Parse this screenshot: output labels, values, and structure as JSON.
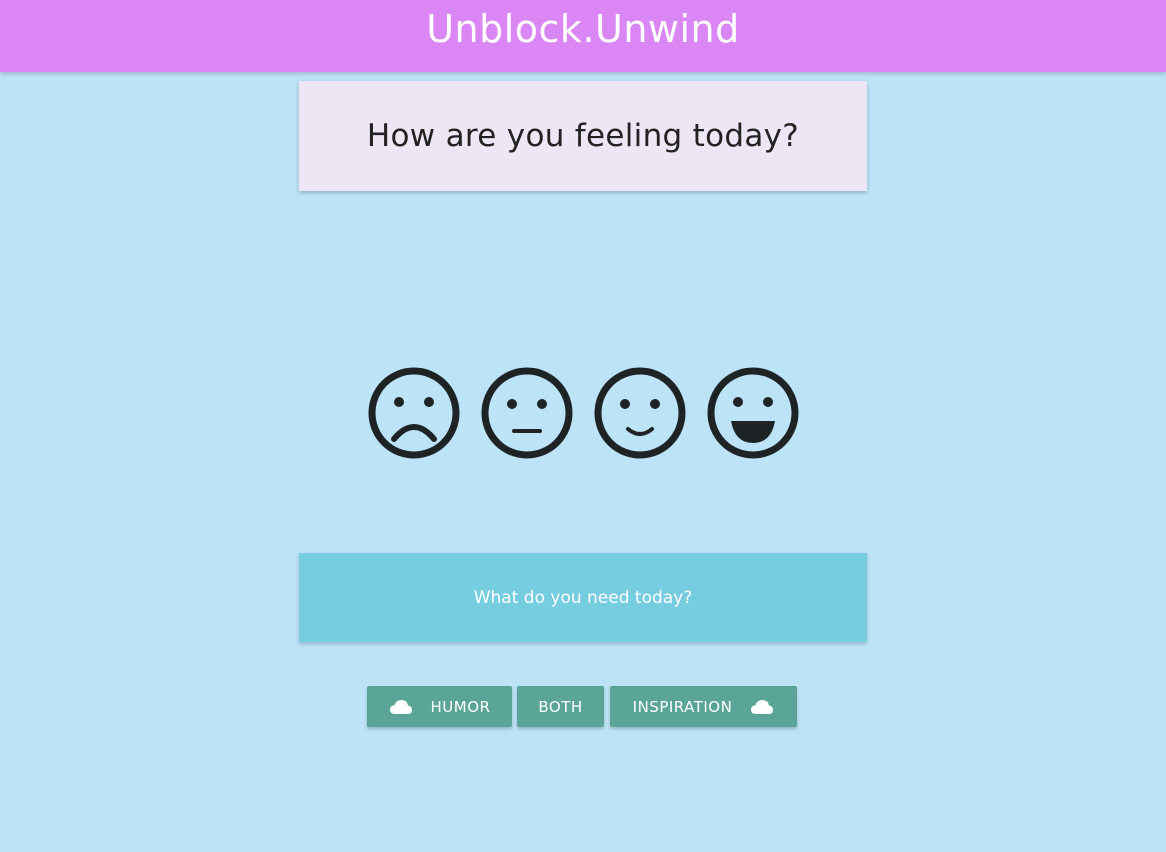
{
  "header": {
    "title": "Unblock.Unwind"
  },
  "question": {
    "text": "How are you feeling today?"
  },
  "moods": [
    {
      "name": "sad",
      "icon": "sad-face-icon"
    },
    {
      "name": "neutral",
      "icon": "neutral-face-icon"
    },
    {
      "name": "content",
      "icon": "slight-smile-face-icon"
    },
    {
      "name": "happy",
      "icon": "big-smile-face-icon"
    }
  ],
  "needs": {
    "prompt": "What do you need today?"
  },
  "buttons": {
    "humor": "HUMOR",
    "both": "BOTH",
    "inspiration": "INSPIRATION"
  },
  "colors": {
    "background": "#bde3f7",
    "header": "#da87f5",
    "question_card": "#ede6f5",
    "needs_card": "#76cde0",
    "button": "#5aa597",
    "face_stroke": "#1e2426"
  }
}
